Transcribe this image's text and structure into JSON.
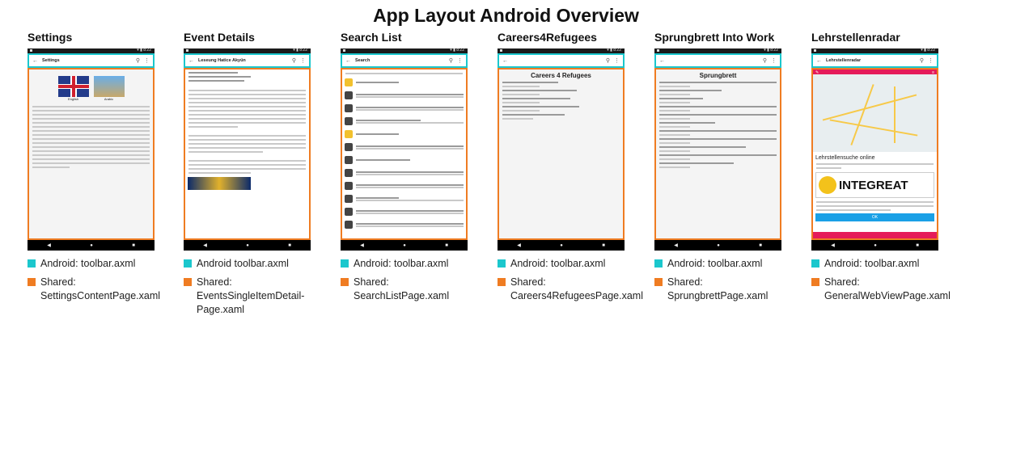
{
  "title": "App Layout Android Overview",
  "colors": {
    "toolbar_highlight": "#1bc7cd",
    "shared_highlight": "#ef7c22"
  },
  "columns": [
    {
      "heading": "Settings",
      "legend": [
        "Android: toolbar.axml",
        "Shared: SettingsContentPage.xaml"
      ]
    },
    {
      "heading": "Event Details",
      "legend": [
        "Android toolbar.axml",
        "Shared: EventsSingleItemDetail-Page.xaml"
      ]
    },
    {
      "heading": "Search List",
      "legend": [
        "Android: toolbar.axml",
        "Shared: SearchListPage.xaml"
      ]
    },
    {
      "heading": "Careers4Refugees",
      "legend": [
        "Android: toolbar.axml",
        "Shared: Careers4RefugeesPage.xaml"
      ]
    },
    {
      "heading": "Sprungbrett Into Work",
      "legend": [
        "Android: toolbar.axml",
        "Shared: SprungbrettPage.xaml"
      ]
    },
    {
      "heading": "Lehrstellenradar",
      "legend": [
        "Android: toolbar.axml",
        "Shared: GeneralWebViewPage.xaml"
      ]
    }
  ],
  "phones": {
    "settings": {
      "toolbar_title": "Settings",
      "lang_a": "English",
      "lang_b": "Arabic"
    },
    "event": {
      "toolbar_title": "Leseung Hatice Akyün"
    },
    "search": {
      "toolbar_title": "Search"
    },
    "careers": {
      "header": "Careers 4 Refugees"
    },
    "sprungbrett": {
      "header": "Sprungbrett"
    },
    "lehrstellen": {
      "toolbar_title": "Lehrstellenradar",
      "section_title": "Lehrstellensuche online",
      "logo_text": "INTEGREAT",
      "ok_label": "OK"
    }
  }
}
